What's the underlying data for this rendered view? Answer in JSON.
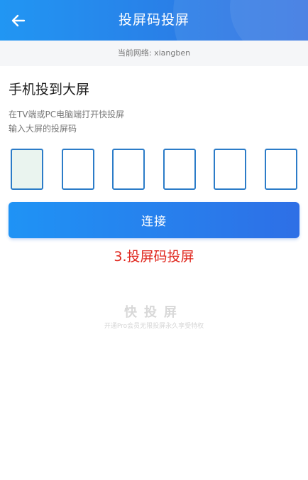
{
  "header": {
    "title": "投屏码投屏",
    "back_icon": "arrow-left-icon"
  },
  "network": {
    "text": "当前网络: xiangben"
  },
  "main": {
    "section_title": "手机投到大屏",
    "desc_line1": "在TV端或PC电脑端打开快投屏",
    "desc_line2": "输入大屏的投屏码",
    "code_inputs": [
      "",
      "",
      "",
      "",
      "",
      ""
    ],
    "connect_label": "连接"
  },
  "annotation": {
    "step_label": "3.投屏码投屏"
  },
  "watermark": {
    "title": "快投屏",
    "subtitle": "开通Pro会员无限投屏永久享受特权"
  },
  "colors": {
    "primary": "#2196f3",
    "accent_red": "#e0281f",
    "input_border": "#2c7cc8"
  }
}
